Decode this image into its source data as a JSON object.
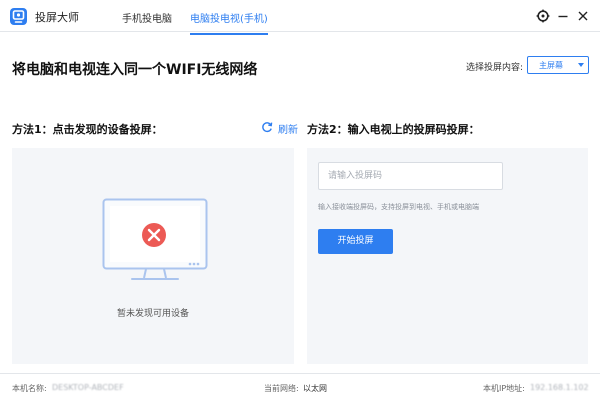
{
  "app": {
    "title": "投屏大师"
  },
  "tabs": [
    {
      "label": "手机投电脑",
      "active": false
    },
    {
      "label": "电脑投电视(手机)",
      "active": true
    }
  ],
  "window_controls": {
    "settings_icon": "settings-gear-icon",
    "minimize_icon": "minimize-icon",
    "close_icon": "close-icon"
  },
  "main": {
    "headline": "将电脑和电视连入同一个WIFI无线网络",
    "select": {
      "label": "选择投屏内容:",
      "value": "主屏幕"
    }
  },
  "method1": {
    "title": "方法1：点击发现的设备投屏：",
    "refresh_label": "刷新",
    "empty_text": "暂未发现可用设备"
  },
  "method2": {
    "title": "方法2：输入电视上的投屏码投屏：",
    "input_placeholder": "请输入投屏码",
    "hint": "输入接收端投屏码，支持投屏到电视、手机或电脑端",
    "start_button": "开始投屏"
  },
  "status": {
    "host_label": "本机名称:",
    "host_value": "DESKTOP-ABCDEF",
    "network_label": "当前网络:",
    "network_value": "以太网",
    "ip_label": "本机IP地址:",
    "ip_value": "192.168.1.102"
  },
  "colors": {
    "accent": "#2e7ef0",
    "error": "#ec5a55",
    "panel_bg": "#f4f6f9"
  }
}
